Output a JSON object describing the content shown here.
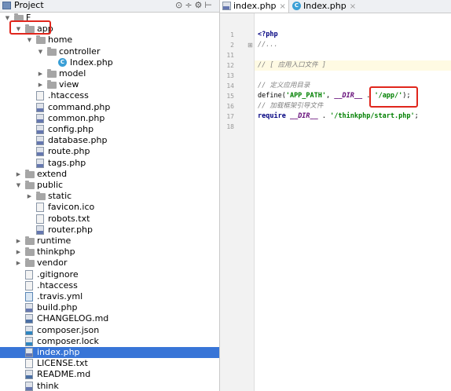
{
  "project_panel": {
    "title": "Project",
    "toolbar_icons": [
      "target-icon",
      "split-icon",
      "gear-icon",
      "collapse-icon"
    ],
    "tree": [
      {
        "label": "F",
        "kind": "folder",
        "depth": 0,
        "expanded": true
      },
      {
        "label": "app",
        "kind": "folder",
        "depth": 1,
        "expanded": true,
        "highlighted": true
      },
      {
        "label": "home",
        "kind": "folder",
        "depth": 2,
        "expanded": true
      },
      {
        "label": "controller",
        "kind": "folder",
        "depth": 3,
        "expanded": true
      },
      {
        "label": "Index.php",
        "kind": "class",
        "depth": 4
      },
      {
        "label": "model",
        "kind": "folder",
        "depth": 3
      },
      {
        "label": "view",
        "kind": "folder",
        "depth": 3,
        "collapsed": true
      },
      {
        "label": ".htaccess",
        "kind": "htaccess",
        "depth": 2
      },
      {
        "label": "command.php",
        "kind": "php",
        "depth": 2
      },
      {
        "label": "common.php",
        "kind": "php",
        "depth": 2
      },
      {
        "label": "config.php",
        "kind": "php",
        "depth": 2
      },
      {
        "label": "database.php",
        "kind": "php",
        "depth": 2
      },
      {
        "label": "route.php",
        "kind": "php",
        "depth": 2
      },
      {
        "label": "tags.php",
        "kind": "php",
        "depth": 2
      },
      {
        "label": "extend",
        "kind": "folder",
        "depth": 1,
        "collapsed": true
      },
      {
        "label": "public",
        "kind": "folder",
        "depth": 1,
        "expanded": true
      },
      {
        "label": "static",
        "kind": "folder",
        "depth": 2,
        "collapsed": true
      },
      {
        "label": "favicon.ico",
        "kind": "img",
        "depth": 2
      },
      {
        "label": "robots.txt",
        "kind": "txt",
        "depth": 2
      },
      {
        "label": "router.php",
        "kind": "php",
        "depth": 2
      },
      {
        "label": "runtime",
        "kind": "folder",
        "depth": 1,
        "collapsed": true
      },
      {
        "label": "thinkphp",
        "kind": "folder",
        "depth": 1,
        "collapsed": true
      },
      {
        "label": "vendor",
        "kind": "folder",
        "depth": 1,
        "collapsed": true
      },
      {
        "label": ".gitignore",
        "kind": "txt",
        "depth": 1
      },
      {
        "label": ".htaccess",
        "kind": "htaccess",
        "depth": 1
      },
      {
        "label": ".travis.yml",
        "kind": "yml",
        "depth": 1
      },
      {
        "label": "build.php",
        "kind": "php",
        "depth": 1
      },
      {
        "label": "CHANGELOG.md",
        "kind": "md",
        "depth": 1
      },
      {
        "label": "composer.json",
        "kind": "json",
        "depth": 1
      },
      {
        "label": "composer.lock",
        "kind": "json",
        "depth": 1
      },
      {
        "label": "index.php",
        "kind": "php",
        "depth": 1,
        "selected": true
      },
      {
        "label": "LICENSE.txt",
        "kind": "txt",
        "depth": 1
      },
      {
        "label": "README.md",
        "kind": "md",
        "depth": 1
      },
      {
        "label": "think",
        "kind": "php",
        "depth": 1
      }
    ]
  },
  "editor": {
    "tabs": [
      {
        "label": "index.php",
        "active": true,
        "close": "×"
      },
      {
        "label": "Index.php",
        "active": false,
        "close": "×"
      }
    ],
    "lines": [
      {
        "num": "1",
        "fold": "",
        "tokens": [
          {
            "t": "<?php",
            "c": "kw"
          }
        ]
      },
      {
        "num": "2",
        "fold": "⊞",
        "tokens": [
          {
            "t": "//...",
            "c": "cm"
          }
        ]
      },
      {
        "num": "11",
        "fold": "",
        "tokens": []
      },
      {
        "num": "12",
        "fold": "",
        "tokens": [
          {
            "t": "// [ 应用入口文件 ]",
            "c": "cm"
          }
        ]
      },
      {
        "num": "13",
        "fold": "",
        "tokens": []
      },
      {
        "num": "14",
        "fold": "",
        "tokens": [
          {
            "t": "// 定义应用目录",
            "c": "cm"
          }
        ]
      },
      {
        "num": "15",
        "fold": "",
        "tokens": [
          {
            "t": "define(",
            "c": "pl"
          },
          {
            "t": "'APP_PATH'",
            "c": "st"
          },
          {
            "t": ", ",
            "c": "pl"
          },
          {
            "t": "__DIR__",
            "c": "cn"
          },
          {
            "t": " . ",
            "c": "pl"
          },
          {
            "t": "'/app/'",
            "c": "st"
          },
          {
            "t": ");",
            "c": "pl"
          }
        ]
      },
      {
        "num": "16",
        "fold": "",
        "tokens": [
          {
            "t": "// 加载框架引导文件",
            "c": "cm"
          }
        ]
      },
      {
        "num": "17",
        "fold": "",
        "tokens": [
          {
            "t": "require ",
            "c": "kw"
          },
          {
            "t": "__DIR__",
            "c": "cn"
          },
          {
            "t": " . ",
            "c": "pl"
          },
          {
            "t": "'/thinkphp/start.php'",
            "c": "st"
          },
          {
            "t": ";",
            "c": "pl"
          }
        ]
      },
      {
        "num": "18",
        "fold": "",
        "tokens": []
      }
    ]
  },
  "colors": {
    "selection": "#3875d7",
    "annotation_red": "#e0261c",
    "keyword": "#000080",
    "string": "#008000",
    "comment": "#808080",
    "constant": "#660e7a"
  }
}
